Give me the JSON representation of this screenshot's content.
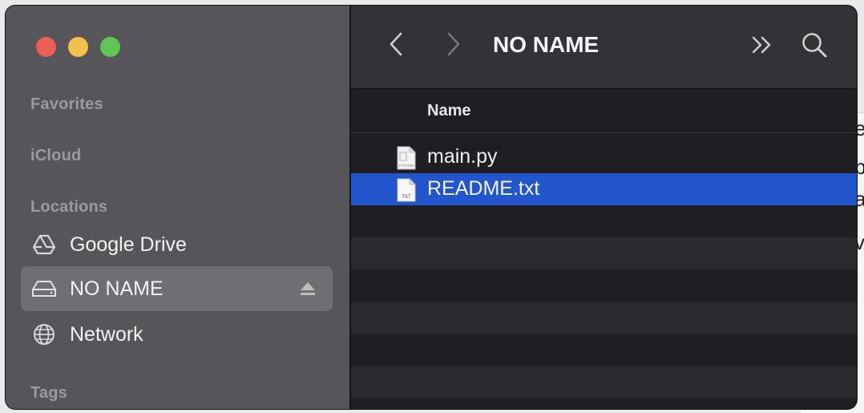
{
  "background_doc_glyphs": [
    "e",
    "p",
    "a",
    "v"
  ],
  "sidebar": {
    "sections": {
      "favorites": "Favorites",
      "icloud": "iCloud",
      "locations": "Locations",
      "tags": "Tags"
    },
    "items": [
      {
        "label": "Google Drive",
        "icon": "google-drive-icon"
      },
      {
        "label": "NO NAME",
        "icon": "external-drive-icon",
        "selected": true
      },
      {
        "label": "Network",
        "icon": "globe-icon"
      }
    ]
  },
  "toolbar": {
    "title": "NO NAME",
    "back_icon": "chevron-left-icon",
    "forward_icon": "chevron-right-icon",
    "more_icon": "double-chevron-right-icon",
    "search_icon": "search-icon"
  },
  "file_list": {
    "column_name": "Name",
    "files": [
      {
        "name": "main.py",
        "badge": "PYTHON",
        "selected": false
      },
      {
        "name": "README.txt",
        "badge": "TXT",
        "selected": true
      }
    ]
  },
  "colors": {
    "selection": "#2356cc",
    "sidebar_bg": "#56555a",
    "toolbar_bg": "#333236"
  }
}
